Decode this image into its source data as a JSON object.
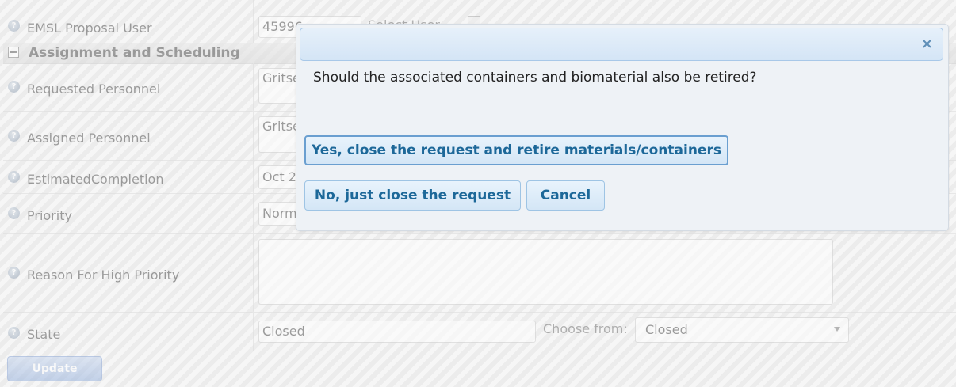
{
  "form": {
    "rows": [
      {
        "label": "EMSL Proposal User",
        "value": "45996",
        "extra": "Select User..."
      },
      {
        "label": "Requested Personnel",
        "value": "Gritse"
      },
      {
        "label": "Assigned Personnel",
        "value": "Gritse"
      },
      {
        "label": "EstimatedCompletion",
        "value": "Oct 2"
      },
      {
        "label": "Priority",
        "value": "Norm"
      },
      {
        "label": "Reason For High Priority",
        "value": ""
      },
      {
        "label": "State",
        "value": "Closed",
        "choose_label": "Choose from:",
        "choose_value": "Closed"
      }
    ],
    "section_title": "Assignment and Scheduling",
    "update_label": "Update"
  },
  "dialog": {
    "close_glyph": "×",
    "message": "Should the associated containers and biomaterial also be retired?",
    "buttons": {
      "yes": "Yes, close the request and retire materials/containers",
      "no": "No, just close the request",
      "cancel": "Cancel"
    }
  }
}
